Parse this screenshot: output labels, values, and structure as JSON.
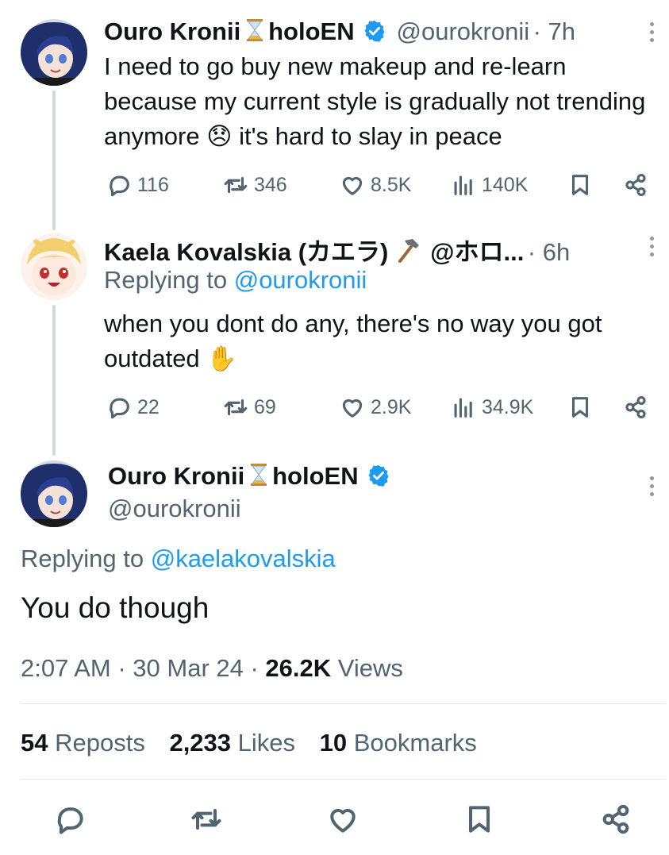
{
  "tweets": [
    {
      "name": "Ouro Kronii",
      "name_suffix": "holoEN",
      "handle": "@ourokronii",
      "time": "· 7h",
      "text": "I need to go buy new makeup and re-learn because my current style is gradually not trending anymore 😞 it's hard to slay in peace",
      "replies": "116",
      "reposts": "346",
      "likes": "8.5K",
      "views": "140K"
    },
    {
      "name": "Kaela Kovalskia (カエラ)",
      "handle": "@ホロ...",
      "time": "· 6h",
      "replying_label": "Replying to",
      "replying_handle": "@ourokronii",
      "text": "when you dont do any, there's no way you got outdated ✋",
      "replies": "22",
      "reposts": "69",
      "likes": "2.9K",
      "views": "34.9K"
    }
  ],
  "main_tweet": {
    "name": "Ouro Kronii",
    "name_suffix": "holoEN",
    "handle": "@ourokronii",
    "replying_label": "Replying to",
    "replying_handle": "@kaelakovalskia",
    "text": "You do though",
    "timestamp": "2:07 AM · 30 Mar 24 · ",
    "views_count": "26.2K",
    "views_label": " Views",
    "reposts_count": "54",
    "reposts_label": " Reposts",
    "likes_count": "2,233",
    "likes_label": " Likes",
    "bookmarks_count": "10",
    "bookmarks_label": " Bookmarks"
  },
  "icons": [
    "reply-icon",
    "repost-icon",
    "like-icon",
    "views-icon",
    "bookmark-icon",
    "share-icon",
    "hourglass-icon",
    "hammer-icon",
    "verified-badge-icon",
    "more-options-icon"
  ],
  "colors": {
    "accent": "#1d9bf0",
    "secondary_text": "#536471",
    "thread_line": "#cfd9de",
    "divider": "#e1e8ed"
  }
}
